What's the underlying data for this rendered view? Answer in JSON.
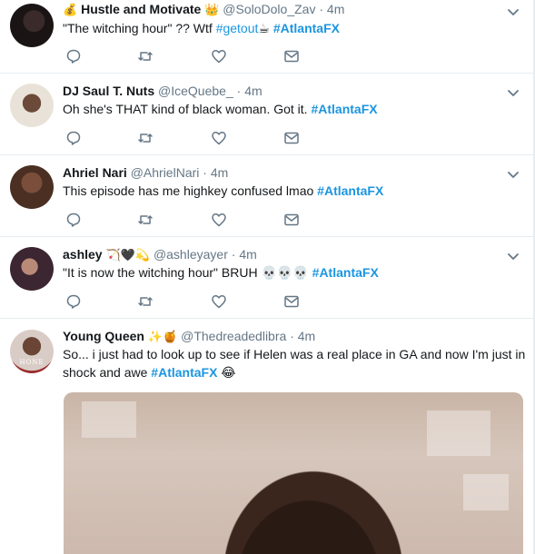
{
  "tweets": [
    {
      "name": "Hustle and Motivate",
      "name_prefix_emoji": "💰",
      "name_suffix_emoji": "👑",
      "handle": "@SoloDolo_Zav",
      "time": "4m",
      "parts": [
        {
          "text": "\"The witching hour\" ?? Wtf ",
          "type": "text"
        },
        {
          "text": "#getout",
          "type": "tag"
        },
        {
          "text": "☕ ",
          "type": "text"
        },
        {
          "text": "#AtlantaFX",
          "type": "tag-bold"
        }
      ]
    },
    {
      "name": "DJ Saul T. Nuts",
      "handle": "@IceQuebe_",
      "time": "4m",
      "parts": [
        {
          "text": "Oh she's THAT kind of black woman. Got it. ",
          "type": "text"
        },
        {
          "text": "#AtlantaFX",
          "type": "tag-bold"
        }
      ]
    },
    {
      "name": "Ahriel Nari",
      "handle": "@AhrielNari",
      "time": "4m",
      "parts": [
        {
          "text": "This episode has me highkey confused lmao ",
          "type": "text"
        },
        {
          "text": "#AtlantaFX",
          "type": "tag-bold"
        }
      ]
    },
    {
      "name": "ashley",
      "name_suffix_emoji": "🏹🖤💫",
      "handle": "@ashleyayer",
      "time": "4m",
      "parts": [
        {
          "text": "\"It is now the witching hour\" BRUH 💀💀💀 ",
          "type": "text"
        },
        {
          "text": "#AtlantaFX",
          "type": "tag-bold"
        }
      ]
    },
    {
      "name": "Young Queen",
      "name_suffix_emoji": "✨🍯",
      "handle": "@Thedreadedlibra",
      "time": "4m",
      "avatar_text": "HONE",
      "line1": "So... i just had to look up to see if Helen was a real place in GA and now I'm just in",
      "line2_parts": [
        {
          "text": "shock and awe ",
          "type": "text"
        },
        {
          "text": "#AtlantaFX",
          "type": "tag-bold"
        },
        {
          "text": " 😂",
          "type": "text"
        }
      ]
    }
  ],
  "separator": "·",
  "icons": {
    "reply": "reply-icon",
    "retweet": "retweet-icon",
    "like": "heart-icon",
    "dm": "envelope-icon",
    "menu": "chevron-down-icon"
  },
  "colors": {
    "link": "#1b95e0",
    "muted": "#657786",
    "text": "#14171a",
    "divider": "#e6ecf0"
  }
}
